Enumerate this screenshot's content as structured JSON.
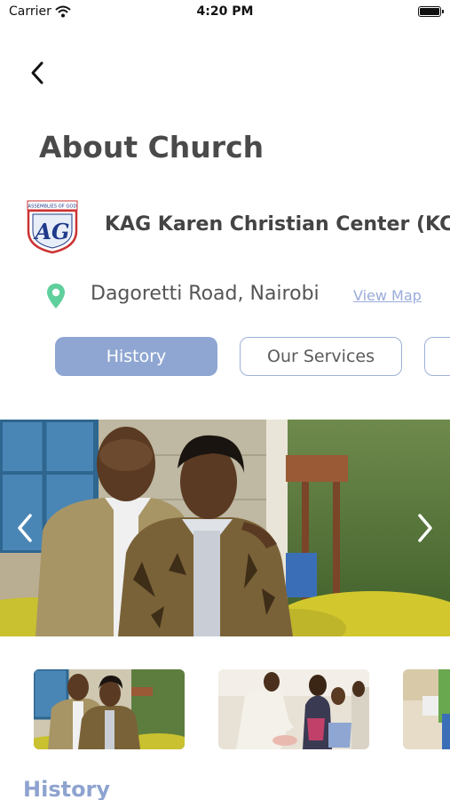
{
  "status_bar": {
    "carrier": "Carrier",
    "time": "4:20 PM"
  },
  "header": {
    "title": "About Church",
    "back_icon": "chevron-left-icon"
  },
  "church": {
    "name": "KAG Karen Christian Center (KC",
    "logo": {
      "top_text": "ASSEMBLIES OF GOD",
      "letters": "AG"
    },
    "address": "Dagoretti Road, Nairobi",
    "view_map": "View Map"
  },
  "tabs": [
    {
      "label": "History",
      "active": true
    },
    {
      "label": "Our Services",
      "active": false
    },
    {
      "label": "",
      "active": false
    }
  ],
  "carousel": {
    "prev_icon": "chevron-left-icon",
    "next_icon": "chevron-right-icon"
  },
  "section": {
    "heading": "History"
  },
  "colors": {
    "accent": "#8fa6d2",
    "link": "#9aabdc",
    "pin": "#5fcf9c",
    "title": "#4a4a4a"
  }
}
